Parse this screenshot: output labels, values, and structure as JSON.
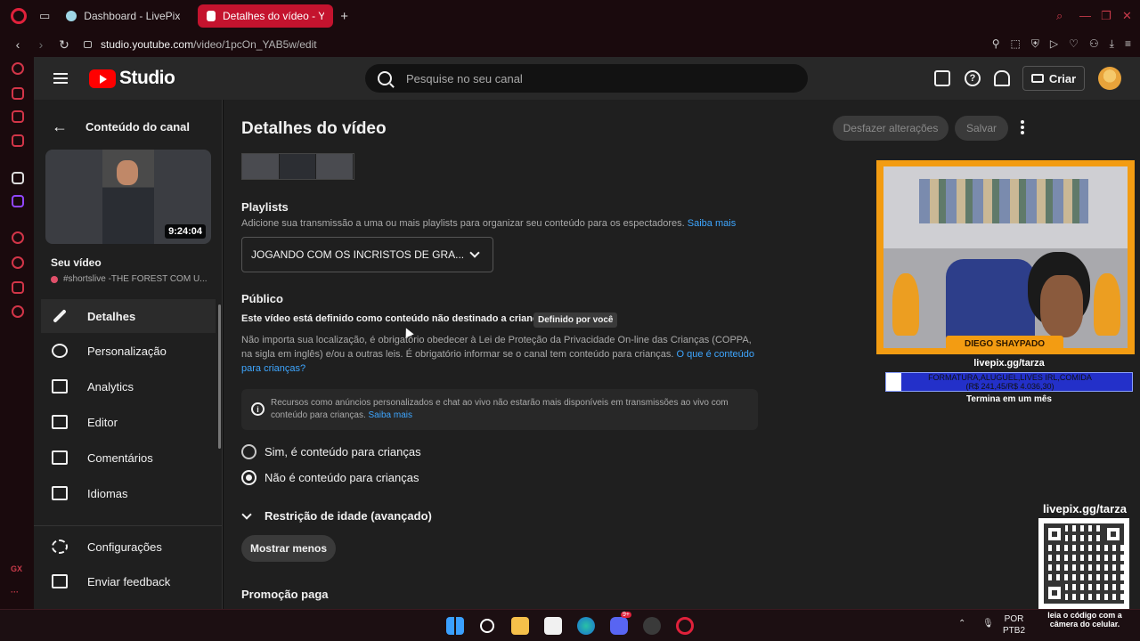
{
  "browser": {
    "tabs": [
      {
        "title": "Dashboard - LivePix",
        "active": false
      },
      {
        "title": "Detalhes do vídeo - YouTu",
        "active": true
      }
    ],
    "url_host": "studio.youtube.com",
    "url_path": "/video/1pcOn_YAB5w/edit"
  },
  "header": {
    "brand": "Studio",
    "search_placeholder": "Pesquise no seu canal",
    "help_glyph": "?",
    "create_label": "Criar"
  },
  "sidebar": {
    "back_label": "Conteúdo do canal",
    "thumbnail_duration": "9:24:04",
    "your_video_label": "Seu vídeo",
    "video_title": "#shortslive -THE FOREST COM U...",
    "items": [
      {
        "label": "Detalhes",
        "icon": "pencil-icon",
        "active": true
      },
      {
        "label": "Personalização",
        "icon": "broadcast-icon",
        "active": false
      },
      {
        "label": "Analytics",
        "icon": "analytics-icon",
        "active": false
      },
      {
        "label": "Editor",
        "icon": "editor-icon",
        "active": false
      },
      {
        "label": "Comentários",
        "icon": "comments-icon",
        "active": false
      },
      {
        "label": "Idiomas",
        "icon": "subtitles-icon",
        "active": false
      }
    ],
    "footer": [
      {
        "label": "Configurações",
        "icon": "gear-icon"
      },
      {
        "label": "Enviar feedback",
        "icon": "feedback-icon"
      }
    ]
  },
  "main": {
    "title": "Detalhes do vídeo",
    "undo_label": "Desfazer alterações",
    "save_label": "Salvar",
    "playlists": {
      "title": "Playlists",
      "desc": "Adicione sua transmissão a uma ou mais playlists para organizar seu conteúdo para os espectadores.",
      "link": "Saiba mais",
      "selected": "JOGANDO COM OS INCRISTOS DE GRA..."
    },
    "audience": {
      "title": "Público",
      "status": "Este vídeo está definido como conteúdo não destinado a crianças",
      "badge": "Definido por você",
      "desc": "Não importa sua localização, é obrigatório obedecer à Lei de Proteção da Privacidade On-line das Crianças (COPPA, na sigla em inglês) e/ou a outras leis. É obrigatório informar se o canal tem conteúdo para crianças.",
      "desc_link": "O que é conteúdo para crianças?",
      "info_text": "Recursos como anúncios personalizados e chat ao vivo não estarão mais disponíveis em transmissões ao vivo com conteúdo para crianças.",
      "info_link": "Saiba mais",
      "info_glyph": "i",
      "option_yes": "Sim, é conteúdo para crianças",
      "option_no": "Não é conteúdo para crianças",
      "selected": "no"
    },
    "age_restriction": "Restrição de idade (avançado)",
    "show_less": "Mostrar menos",
    "paid_promo": "Promoção paga"
  },
  "overlay": {
    "streamer_name": "DIEGO SHAYPADO",
    "livepix_url": "livepix.gg/tarza",
    "goal_text_1": "FORMATURA,ALUGUEL,LIVES IRL,COMIDA",
    "goal_text_2": "(R$ 241,45/R$ 4.036,30)",
    "goal_progress": 0.06,
    "goal_footer": "Termina em um mês",
    "qr_title": "livepix.gg/tarza",
    "qr_caption": "leia o código com a câmera do celular."
  },
  "taskbar": {
    "lang_line1": "POR",
    "lang_line2": "PTB2",
    "discord_badge": "9+"
  },
  "colors": {
    "opera_red": "#e0213b",
    "yt_red": "#ff0000",
    "link_blue": "#3ea6ff",
    "overlay_orange": "#f39c12",
    "goal_blue": "#2330c9"
  }
}
